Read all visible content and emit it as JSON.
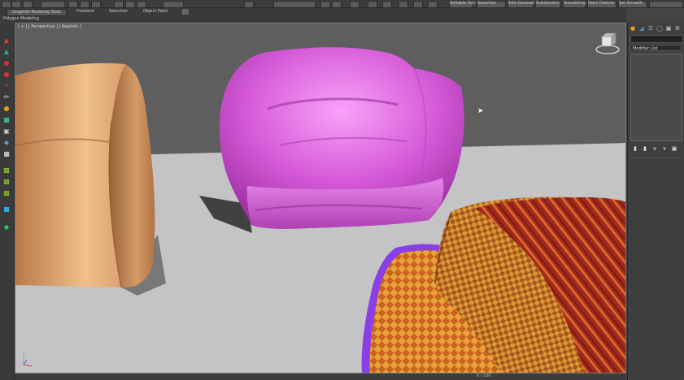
{
  "toolbar": {
    "ribbon_tabs": [
      "Graphite Modeling Tools",
      "Freeform",
      "Selection",
      "Object Paint"
    ],
    "ribbon_subtitle": "Polygon Modeling",
    "top_buttons": [
      "Editable Poly",
      "Selection",
      "Edit Geometry",
      "Subdivision",
      "Smoothing",
      "Paint Deform",
      "Set Smooth"
    ]
  },
  "viewport": {
    "label": "[ + ] [ Perspective ] [ Realistic ]",
    "gizmo_axes": "z x"
  },
  "command_panel": {
    "modifier_list_label": "Modifier List"
  },
  "statusbar": {
    "frame_counter": "0 / 100"
  },
  "colors": {
    "pillow_pink": "#d65ad8",
    "beanbag_tan": "#d9a06e",
    "floor_gray": "#c4c4c6",
    "background_gray": "#5e5e5e",
    "rug_orange": "#c8641c",
    "rug_border_purple": "#8a3ee6",
    "stripe_red": "#a0281c"
  }
}
